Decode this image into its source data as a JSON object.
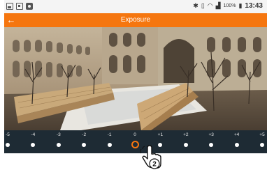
{
  "status_bar": {
    "notification_icons": [
      "image-icon",
      "image-icon",
      "camera-icon"
    ],
    "battery_percent": "100%",
    "time": "13:43"
  },
  "action_bar": {
    "back_icon": "arrow-left-icon",
    "title": "Exposure"
  },
  "exposure": {
    "ticks": [
      "-5",
      "-4",
      "-3",
      "-2",
      "-1",
      "0",
      "+1",
      "+2",
      "+3",
      "+4",
      "+5"
    ],
    "selected": "0"
  },
  "callout": {
    "step_number": "2",
    "icon": "tap-hand-icon"
  },
  "colors": {
    "accent": "#f5760f",
    "panel": "#1e2b34",
    "status_bar": "#f4f4f4"
  }
}
